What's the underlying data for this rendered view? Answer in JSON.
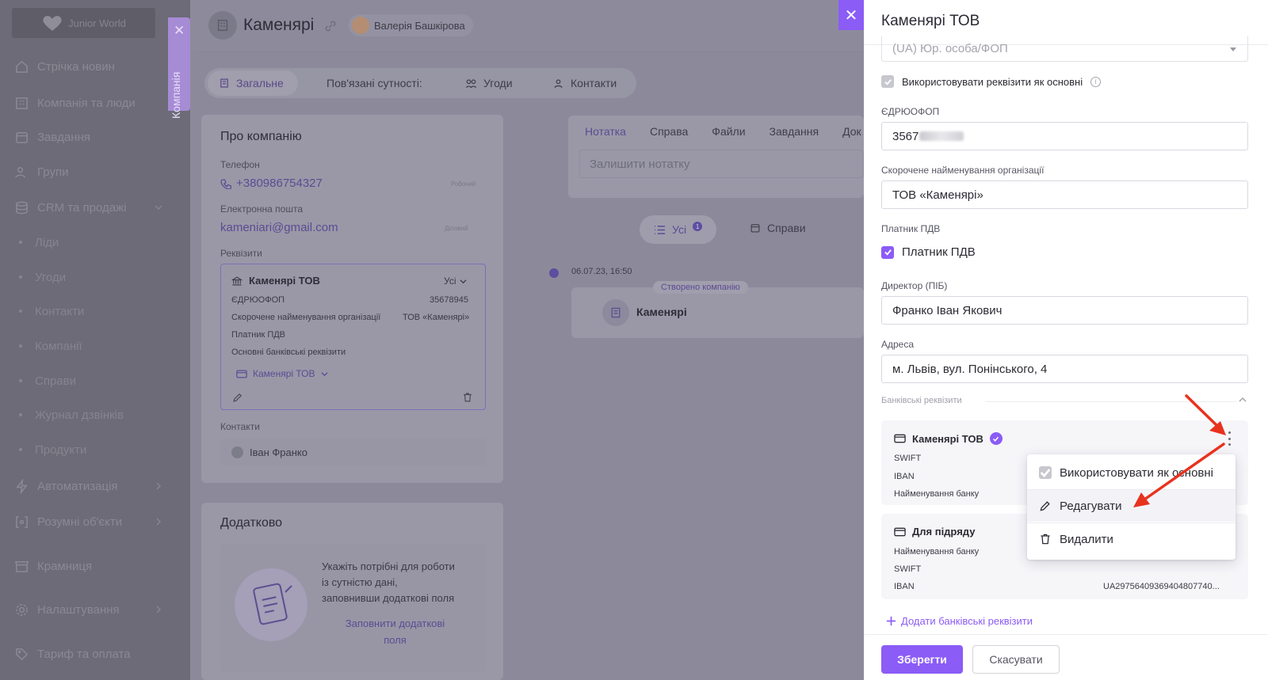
{
  "sidebar": {
    "logo_text": "Junior World",
    "items": [
      {
        "label": "Стрічка новин",
        "icon": "home-icon"
      },
      {
        "label": "Компанія та люди",
        "icon": "building-icon"
      },
      {
        "label": "Завдання",
        "icon": "calendar-icon"
      },
      {
        "label": "Групи",
        "icon": "users-icon"
      },
      {
        "label": "CRM та продажі",
        "icon": "database-icon"
      }
    ],
    "crm_subitems": [
      "Ліди",
      "Угоди",
      "Контакти",
      "Компанії",
      "Справи",
      "Журнал дзвінків",
      "Продукти"
    ],
    "bottom_items": [
      {
        "label": "Автоматизація",
        "icon": "bolt-icon"
      },
      {
        "label": "Розумні об'єкти",
        "icon": "bracket-icon"
      },
      {
        "label": "Крамниця",
        "icon": "store-icon"
      },
      {
        "label": "Налаштування",
        "icon": "gear-icon"
      },
      {
        "label": "Тариф та оплата",
        "icon": "tag-icon"
      }
    ],
    "side_tab_label": "Компанія"
  },
  "main": {
    "title": "Каменярі",
    "user_name": "Валерія Башкірова",
    "tabs": {
      "general": "Загальне",
      "related": "Пов'язані сутності:",
      "deals": "Угоди",
      "contacts": "Контакти"
    },
    "about": {
      "title": "Про компанію",
      "phone_label": "Телефон",
      "phone": "+380986754327",
      "phone_tag": "Робочий",
      "email_label": "Електронна пошта",
      "email": "kameniari@gmail.com",
      "email_tag": "Діловий",
      "req_label": "Реквізити",
      "req_name": "Каменярі ТОВ",
      "req_filter": "Усі",
      "req_rows": {
        "edrpou_label": "ЄДРЮОФОП",
        "edrpou": "35678945",
        "short_label": "Скорочене найменування організації",
        "short_value": "ТОВ «Каменярі»",
        "vat": "Платник ПДВ",
        "bank_main": "Основні банківські реквізити",
        "bank_link": "Каменярі ТОВ"
      },
      "contacts_label": "Контакти",
      "contact_name": "Іван Франко"
    },
    "extra": {
      "title": "Додатково",
      "text_1": "Укажіть потрібні для роботи",
      "text_2": "із сутністю дані,",
      "text_3": "заповнивши додаткові поля",
      "link_1": "Заповнити додаткові",
      "link_2": "поля"
    },
    "notes": {
      "tabs": [
        "Нотатка",
        "Справа",
        "Файли",
        "Завдання",
        "Док"
      ],
      "placeholder": "Залишити нотатку"
    },
    "feed": {
      "filter_all": "Усі",
      "filter_badge": "1",
      "filter_cases": "Справи",
      "date": "06.07.23, 16:50",
      "event_tag": "Створено компанію",
      "event_name": "Каменярі"
    }
  },
  "drawer": {
    "title": "Каменярі ТОВ",
    "entity_type_value": "(UA) Юр. особа/ФОП",
    "use_as_main": "Використовувати реквізити як основні",
    "edrpou_label": "ЄДРЮОФОП",
    "edrpou_value": "3567",
    "short_label": "Скорочене найменування організації",
    "short_value": "ТОВ «Каменярі»",
    "vat_label": "Платник ПДВ",
    "vat_checkbox": "Платник ПДВ",
    "director_label": "Директор (ПІБ)",
    "director_value": "Франко Іван Якович",
    "address_label": "Адреса",
    "address_value": "м. Львів, вул. Понінського, 4",
    "bank_section": "Банківські реквізити",
    "banks": [
      {
        "name": "Каменярі ТОВ",
        "rows": [
          "SWIFT",
          "IBAN",
          "Найменування банку"
        ]
      },
      {
        "name": "Для підряду",
        "rows": [
          "Найменування банку",
          "SWIFT",
          "IBAN"
        ],
        "iban_value": "UA29756409369404807740..."
      }
    ],
    "menu": {
      "use_main": "Використовувати як основні",
      "edit": "Редагувати",
      "delete": "Видалити"
    },
    "add_bank": "Додати банківські реквізити",
    "save": "Зберегти",
    "cancel": "Скасувати"
  },
  "colors": {
    "accent": "#8b5cf6",
    "arrow": "#e8321e"
  }
}
